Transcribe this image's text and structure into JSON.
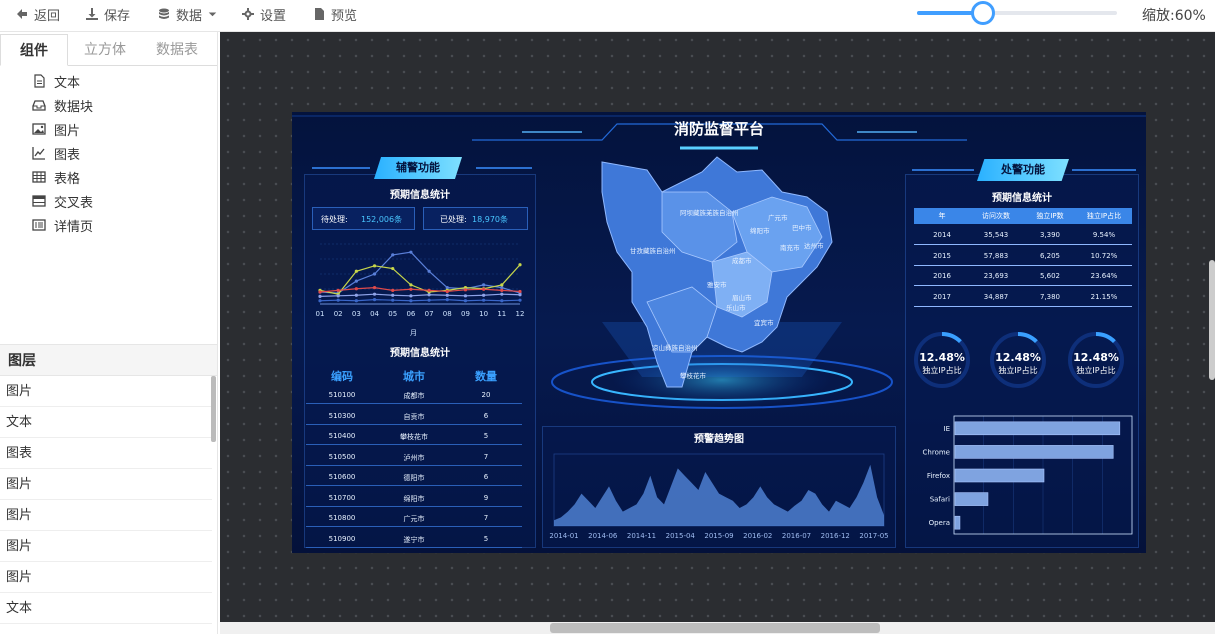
{
  "toolbar": {
    "back": "返回",
    "save": "保存",
    "data": "数据",
    "settings": "设置",
    "preview": "预览",
    "zoom_label": "缩放:",
    "zoom_value": "60%",
    "zoom_fraction": 0.33
  },
  "left_tabs": [
    "组件",
    "立方体",
    "数据表"
  ],
  "components": [
    "文本",
    "数据块",
    "图片",
    "图表",
    "表格",
    "交叉表",
    "详情页"
  ],
  "layers": {
    "title": "图层",
    "items": [
      "图片",
      "文本",
      "图表",
      "图片",
      "图片",
      "图片",
      "图片",
      "文本"
    ]
  },
  "dashboard": {
    "title": "消防监督平台",
    "left_badge": "辅警功能",
    "right_badge": "处警功能",
    "stats_title_1": "预期信息统计",
    "pending_label": "待处理:",
    "pending_value": "152,006条",
    "done_label": "已处理:",
    "done_value": "18,970条",
    "month_unit": "月",
    "stats_title_2": "预期信息统计",
    "code_table": {
      "headers": [
        "编码",
        "城市",
        "数量"
      ],
      "rows": [
        [
          "510100",
          "成都市",
          "20"
        ],
        [
          "510300",
          "自贡市",
          "6"
        ],
        [
          "510400",
          "攀枝花市",
          "5"
        ],
        [
          "510500",
          "泸州市",
          "7"
        ],
        [
          "510600",
          "德阳市",
          "6"
        ],
        [
          "510700",
          "绵阳市",
          "9"
        ],
        [
          "510800",
          "广元市",
          "7"
        ],
        [
          "510900",
          "遂宁市",
          "5"
        ]
      ]
    },
    "map_labels": [
      "阿坝藏族羌族自治州",
      "甘孜藏族自治州",
      "成都市",
      "凉山彝族自治州",
      "广元市",
      "巴中市",
      "绵阳市",
      "南充市",
      "达州市",
      "雅安市",
      "眉山市",
      "乐山市",
      "宜宾市",
      "攀枝花市"
    ],
    "trend_title": "预警趋势图",
    "right_stats_title": "预期信息统计",
    "visit_table": {
      "headers": [
        "年",
        "访问次数",
        "独立IP数",
        "独立IP占比"
      ],
      "rows": [
        [
          "2014",
          "35,543",
          "3,390",
          "9.54%"
        ],
        [
          "2015",
          "57,883",
          "6,205",
          "10.72%"
        ],
        [
          "2016",
          "23,693",
          "5,602",
          "23.64%"
        ],
        [
          "2017",
          "34,887",
          "7,380",
          "21.15%"
        ]
      ]
    },
    "gauges": [
      {
        "value": "12.48%",
        "label": "独立IP占比",
        "fraction": 0.1248
      },
      {
        "value": "12.48%",
        "label": "独立IP占比",
        "fraction": 0.1248
      },
      {
        "value": "12.48%",
        "label": "独立IP占比",
        "fraction": 0.1248
      }
    ]
  },
  "chart_data": [
    {
      "type": "line",
      "x": [
        "01",
        "02",
        "03",
        "04",
        "05",
        "06",
        "07",
        "08",
        "09",
        "10",
        "11",
        "12"
      ],
      "xlabel": "月",
      "series": [
        {
          "values": [
            22,
            20,
            42,
            55,
            90,
            95,
            60,
            30,
            28,
            35,
            30,
            20
          ],
          "color": "#5a7fd8"
        },
        {
          "values": [
            25,
            18,
            60,
            70,
            65,
            35,
            22,
            25,
            30,
            28,
            35,
            72
          ],
          "color": "#c7d64a"
        },
        {
          "values": [
            22,
            25,
            28,
            30,
            25,
            27,
            25,
            23,
            26,
            27,
            25,
            23
          ],
          "color": "#e04a4a"
        },
        {
          "values": [
            14,
            15,
            16,
            18,
            16,
            15,
            17,
            16,
            15,
            16,
            18,
            17
          ],
          "color": "#8fa3e8"
        },
        {
          "values": [
            6,
            7,
            6,
            8,
            7,
            6,
            7,
            8,
            6,
            7,
            6,
            7
          ],
          "color": "#3a66c8"
        }
      ],
      "ylim": [
        0,
        110
      ]
    },
    {
      "type": "area",
      "title": "预警趋势图",
      "x_ticks": [
        "2014-01",
        "2014-06",
        "2014-11",
        "2015-04",
        "2015-09",
        "2016-02",
        "2016-07",
        "2016-12",
        "2017-05"
      ],
      "values": [
        8,
        12,
        20,
        30,
        45,
        35,
        25,
        40,
        55,
        35,
        20,
        25,
        30,
        45,
        70,
        40,
        30,
        55,
        80,
        70,
        60,
        50,
        75,
        60,
        45,
        40,
        35,
        25,
        30,
        40,
        55,
        40,
        30,
        25,
        20,
        28,
        35,
        50,
        45,
        30,
        20,
        35,
        30,
        25,
        40,
        60,
        85,
        40,
        15
      ],
      "color": "#4d7fd0",
      "ylim": [
        0,
        100
      ]
    },
    {
      "type": "bar",
      "orientation": "horizontal",
      "categories": [
        "IE",
        "Chrome",
        "Firefox",
        "Safari",
        "Opera"
      ],
      "values": [
        100,
        96,
        54,
        20,
        3
      ],
      "color": "#7fa3e0",
      "xlim": [
        0,
        108
      ]
    }
  ]
}
